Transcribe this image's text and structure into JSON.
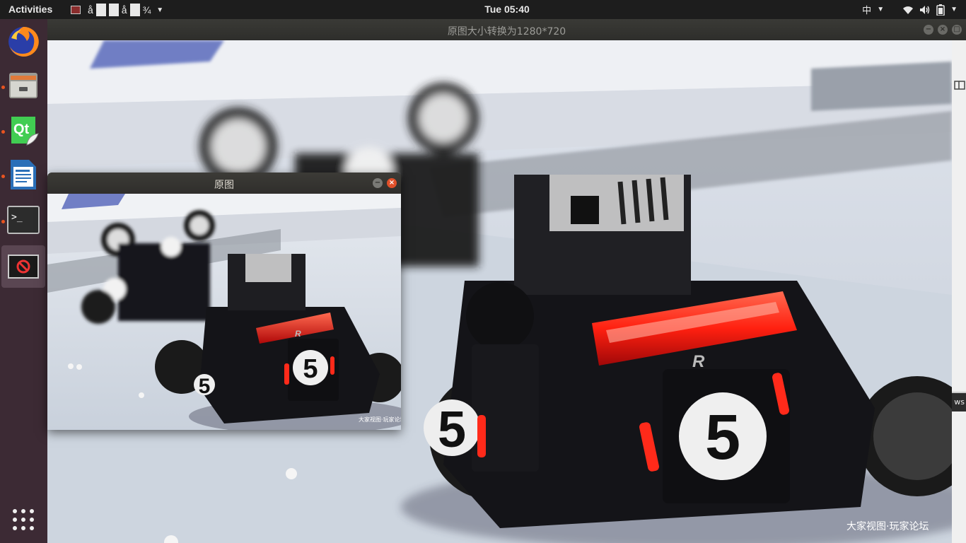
{
  "topbar": {
    "activities": "Activities",
    "app_menu_text": "å",
    "app_menu_text2": "å",
    "app_menu_text3": "¾",
    "clock": "Tue 05:40",
    "input_method": "中"
  },
  "dock": {
    "items": [
      {
        "name": "firefox",
        "running": false
      },
      {
        "name": "files",
        "running": true
      },
      {
        "name": "qt-creator",
        "running": true
      },
      {
        "name": "writer",
        "running": true
      },
      {
        "name": "terminal",
        "running": true
      },
      {
        "name": "opencv-app",
        "running": true,
        "active": true
      }
    ]
  },
  "main_window": {
    "title": "原图大小转换为1280*720",
    "watermark": "大家视图·玩家论坛",
    "side_text": "ws"
  },
  "small_window": {
    "title": "原图",
    "watermark": "大家视图·玩家论坛"
  },
  "scene": {
    "robot_number": "5",
    "robot_logo": "R",
    "colors": {
      "floor": "#cfd6e0",
      "barrier": "#e9ecf1",
      "robot_body": "#1a1a1e",
      "led_red": "#ff2a1a",
      "ubuntu_orange": "#e95420"
    }
  }
}
